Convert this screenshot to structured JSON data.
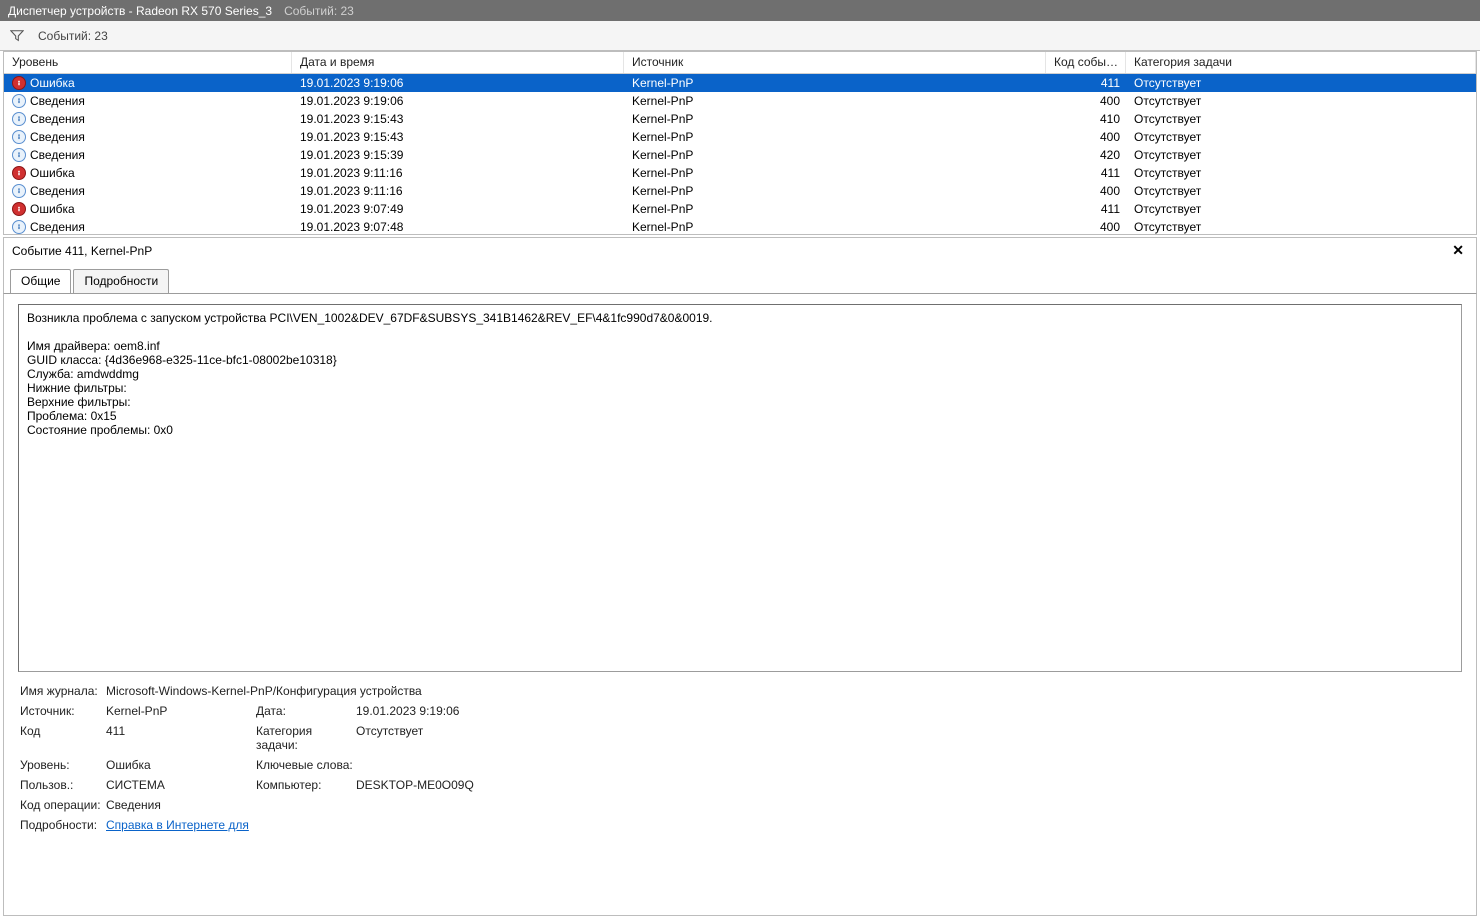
{
  "titlebar": {
    "title": "Диспетчер устройств - Radeon RX 570 Series_3",
    "events_label": "Событий: 23"
  },
  "toolbar": {
    "events_label": "Событий: 23"
  },
  "columns": {
    "level": "Уровень",
    "date": "Дата и время",
    "source": "Источник",
    "id": "Код события",
    "category": "Категория задачи"
  },
  "levels": {
    "error": "Ошибка",
    "info": "Сведения"
  },
  "rows": [
    {
      "type": "error",
      "date": "19.01.2023 9:19:06",
      "source": "Kernel-PnP",
      "id": "411",
      "cat": "Отсутствует",
      "selected": true
    },
    {
      "type": "info",
      "date": "19.01.2023 9:19:06",
      "source": "Kernel-PnP",
      "id": "400",
      "cat": "Отсутствует"
    },
    {
      "type": "info",
      "date": "19.01.2023 9:15:43",
      "source": "Kernel-PnP",
      "id": "410",
      "cat": "Отсутствует"
    },
    {
      "type": "info",
      "date": "19.01.2023 9:15:43",
      "source": "Kernel-PnP",
      "id": "400",
      "cat": "Отсутствует"
    },
    {
      "type": "info",
      "date": "19.01.2023 9:15:39",
      "source": "Kernel-PnP",
      "id": "420",
      "cat": "Отсутствует"
    },
    {
      "type": "error",
      "date": "19.01.2023 9:11:16",
      "source": "Kernel-PnP",
      "id": "411",
      "cat": "Отсутствует"
    },
    {
      "type": "info",
      "date": "19.01.2023 9:11:16",
      "source": "Kernel-PnP",
      "id": "400",
      "cat": "Отсутствует"
    },
    {
      "type": "error",
      "date": "19.01.2023 9:07:49",
      "source": "Kernel-PnP",
      "id": "411",
      "cat": "Отсутствует"
    },
    {
      "type": "info",
      "date": "19.01.2023 9:07:48",
      "source": "Kernel-PnP",
      "id": "400",
      "cat": "Отсутствует"
    }
  ],
  "detail": {
    "header": "Событие 411, Kernel-PnP",
    "tabs": {
      "general": "Общие",
      "details": "Подробности"
    },
    "description": "Возникла проблема с запуском устройства PCI\\VEN_1002&DEV_67DF&SUBSYS_341B1462&REV_EF\\4&1fc990d7&0&0019.\n\nИмя драйвера: oem8.inf\nGUID класса: {4d36e968-e325-11ce-bfc1-08002be10318}\nСлужба: amdwddmg\nНижние фильтры: \nВерхние фильтры: \nПроблема: 0x15\nСостояние проблемы: 0x0",
    "fields": {
      "log_name_label": "Имя журнала:",
      "log_name_value": "Microsoft-Windows-Kernel-PnP/Конфигурация устройства",
      "source_label": "Источник:",
      "source_value": "Kernel-PnP",
      "date_label": "Дата:",
      "date_value": "19.01.2023 9:19:06",
      "id_label": "Код",
      "id_value": "411",
      "cat_label": "Категория задачи:",
      "cat_value": "Отсутствует",
      "level_label": "Уровень:",
      "level_value": "Ошибка",
      "keywords_label": "Ключевые слова:",
      "keywords_value": "",
      "user_label": "Пользов.:",
      "user_value": "СИСТЕМА",
      "computer_label": "Компьютер:",
      "computer_value": "DESKTOP-ME0O09Q",
      "opcode_label": "Код операции:",
      "opcode_value": "Сведения",
      "moreinfo_label": "Подробности:",
      "moreinfo_link": "Справка в Интернете для "
    }
  }
}
